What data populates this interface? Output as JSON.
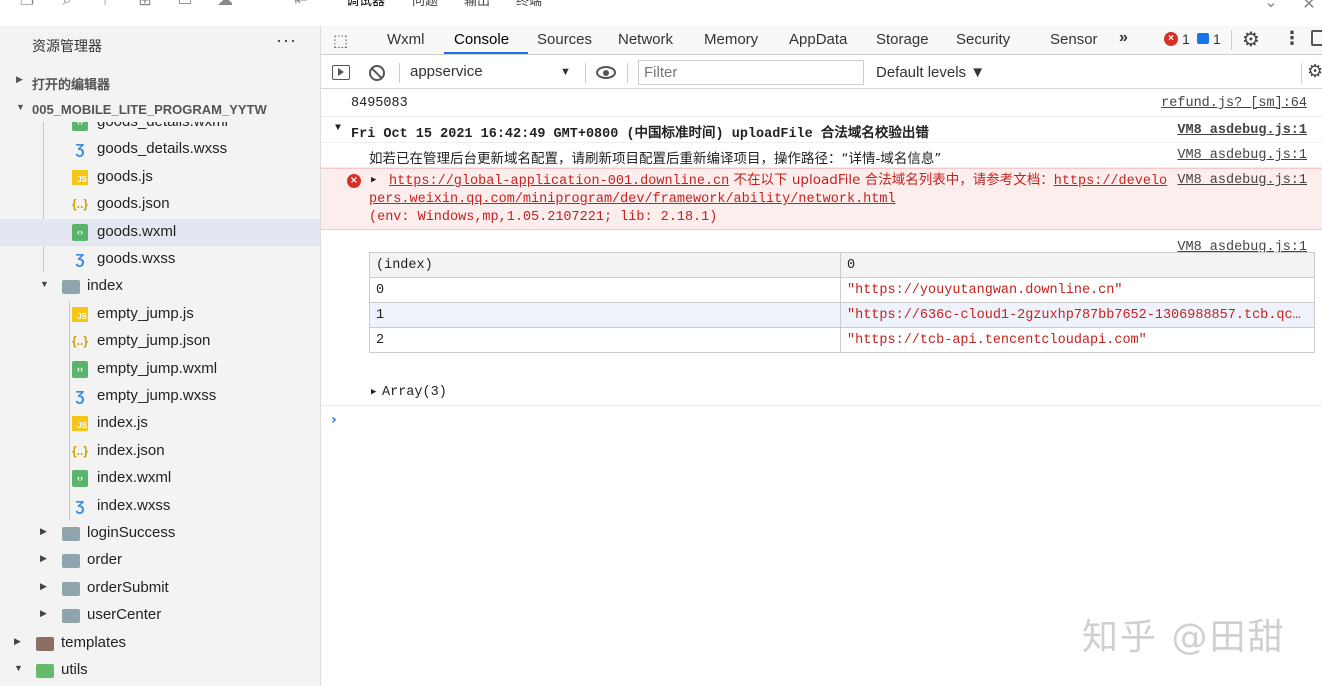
{
  "top_strip": {
    "tabs": [
      "调试器",
      "问题",
      "输出",
      "终端"
    ]
  },
  "sidebar": {
    "title": "资源管理器",
    "more": "···",
    "open_editors": "打开的编辑器",
    "project": "005_MOBILE_LITE_PROGRAM_YYTW",
    "tree": [
      {
        "name": "goods_details.wxml",
        "type": "wxml"
      },
      {
        "name": "goods_details.wxss",
        "type": "wxss"
      },
      {
        "name": "goods.js",
        "type": "js"
      },
      {
        "name": "goods.json",
        "type": "json"
      },
      {
        "name": "goods.wxml",
        "type": "wxml",
        "selected": true
      },
      {
        "name": "goods.wxss",
        "type": "wxss"
      },
      {
        "name": "index",
        "type": "folder",
        "expanded": true
      },
      {
        "name": "empty_jump.js",
        "type": "js"
      },
      {
        "name": "empty_jump.json",
        "type": "json"
      },
      {
        "name": "empty_jump.wxml",
        "type": "wxml"
      },
      {
        "name": "empty_jump.wxss",
        "type": "wxss"
      },
      {
        "name": "index.js",
        "type": "js"
      },
      {
        "name": "index.json",
        "type": "json"
      },
      {
        "name": "index.wxml",
        "type": "wxml"
      },
      {
        "name": "index.wxss",
        "type": "wxss"
      },
      {
        "name": "loginSuccess",
        "type": "folder"
      },
      {
        "name": "order",
        "type": "folder"
      },
      {
        "name": "orderSubmit",
        "type": "folder"
      },
      {
        "name": "userCenter",
        "type": "folder"
      },
      {
        "name": "templates",
        "type": "folder"
      },
      {
        "name": "utils",
        "type": "folder",
        "expanded": true
      }
    ]
  },
  "devtools": {
    "tabs": [
      "Wxml",
      "Console",
      "Sources",
      "Network",
      "Memory",
      "AppData",
      "Storage",
      "Security",
      "Sensor"
    ],
    "active_tab": "Console",
    "more_tabs": "»",
    "error_count": "1",
    "message_count": "1",
    "context": "appservice",
    "filter_placeholder": "Filter",
    "levels": "Default levels ▼"
  },
  "console": {
    "line1": {
      "text": "8495083",
      "source": "refund.js? [sm]:64"
    },
    "group": {
      "text": "Fri Oct 15 2021 16:42:49 GMT+0800 (中国标准时间) uploadFile 合法域名校验出错",
      "source": "VM8 asdebug.js:1"
    },
    "info": {
      "text": "如若已在管理后台更新域名配置，请刷新项目配置后重新编译项目，操作路径：“详情-域名信息”",
      "source": "VM8 asdebug.js:1"
    },
    "error": {
      "url": "https://global-application-001.downline.cn",
      "middle": " 不在以下 uploadFile 合法域名列表中，请参考文档：",
      "doc_link": "https://developers.weixin.qq.com/miniprogram/dev/framework/ability/network.html",
      "env": "(env: Windows,mp,1.05.2107221; lib: 2.18.1)",
      "source": "VM8 asdebug.js:1"
    },
    "table_source": "VM8 asdebug.js:1",
    "table": {
      "headers": [
        "(index)",
        "0"
      ],
      "rows": [
        {
          "index": "0",
          "value": "\"https://youyutangwan.downline.cn\""
        },
        {
          "index": "1",
          "value": "\"https://636c-cloud1-2gzuxhp787bb7652-1306988857.tcb.qc…"
        },
        {
          "index": "2",
          "value": "\"https://tcb-api.tencentcloudapi.com\""
        }
      ]
    },
    "array": "Array(3)",
    "prompt": "›"
  },
  "watermark": "知乎 @田甜"
}
